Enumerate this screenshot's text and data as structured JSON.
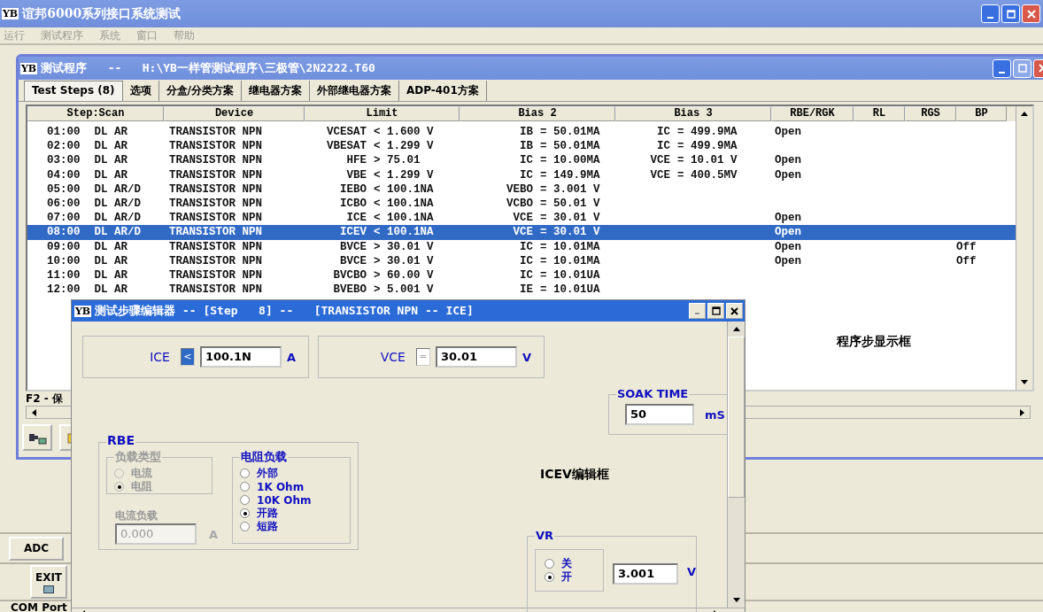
{
  "main_window": {
    "logo": "YB",
    "title": "谊邦6000系列接口系统测试"
  },
  "menu": [
    "运行",
    "测试程序",
    "系统",
    "窗口",
    "帮助"
  ],
  "program_window": {
    "logo": "YB",
    "title": "测试程序   --   H:\\YB一样管测试程序\\三极管\\2N2222.T60"
  },
  "tabs": [
    {
      "label": "Test Steps (8)",
      "selected": true
    },
    {
      "label": "选项",
      "selected": false
    },
    {
      "label": "分盒/分类方案",
      "selected": false
    },
    {
      "label": "继电器方案",
      "selected": false
    },
    {
      "label": "外部继电器方案",
      "selected": false
    },
    {
      "label": "ADP-401方案",
      "selected": false
    }
  ],
  "table": {
    "columns": [
      "Step:Scan",
      "Device",
      "Limit",
      "Bias 2",
      "Bias 3",
      "RBE/RGK",
      "RL",
      "RGS",
      "BP"
    ],
    "rows": [
      {
        "step": "01:00",
        "scan": "DL AR",
        "device": "TRANSISTOR NPN",
        "limit_param": "VCESAT",
        "limit_value": "< 1.600 V",
        "bias2_param": "IB",
        "bias2_value": "= 50.01MA",
        "bias3_param": "IC",
        "bias3_value": "= 499.9MA",
        "rbe": "Open",
        "bp": "",
        "selected": false
      },
      {
        "step": "02:00",
        "scan": "DL AR",
        "device": "TRANSISTOR NPN",
        "limit_param": "VBESAT",
        "limit_value": "< 1.299 V",
        "bias2_param": "IB",
        "bias2_value": "= 50.01MA",
        "bias3_param": "IC",
        "bias3_value": "= 499.9MA",
        "rbe": "",
        "bp": "",
        "selected": false
      },
      {
        "step": "03:00",
        "scan": "DL AR",
        "device": "TRANSISTOR NPN",
        "limit_param": "HFE",
        "limit_value": "> 75.01",
        "bias2_param": "IC",
        "bias2_value": "= 10.00MA",
        "bias3_param": "VCE",
        "bias3_value": "= 10.01 V",
        "rbe": "Open",
        "bp": "",
        "selected": false
      },
      {
        "step": "04:00",
        "scan": "DL AR",
        "device": "TRANSISTOR NPN",
        "limit_param": "VBE",
        "limit_value": "< 1.299 V",
        "bias2_param": "IC",
        "bias2_value": "= 149.9MA",
        "bias3_param": "VCE",
        "bias3_value": "= 400.5MV",
        "rbe": "Open",
        "bp": "",
        "selected": false
      },
      {
        "step": "05:00",
        "scan": "DL AR/D",
        "device": "TRANSISTOR NPN",
        "limit_param": "IEBO",
        "limit_value": "< 100.1NA",
        "bias2_param": "VEBO",
        "bias2_value": "= 3.001 V",
        "bias3_param": "",
        "bias3_value": "",
        "rbe": "",
        "bp": "",
        "selected": false
      },
      {
        "step": "06:00",
        "scan": "DL AR/D",
        "device": "TRANSISTOR NPN",
        "limit_param": "ICBO",
        "limit_value": "< 100.1NA",
        "bias2_param": "VCBO",
        "bias2_value": "= 50.01 V",
        "bias3_param": "",
        "bias3_value": "",
        "rbe": "",
        "bp": "",
        "selected": false
      },
      {
        "step": "07:00",
        "scan": "DL AR/D",
        "device": "TRANSISTOR NPN",
        "limit_param": "ICE",
        "limit_value": "< 100.1NA",
        "bias2_param": "VCE",
        "bias2_value": "= 30.01 V",
        "bias3_param": "",
        "bias3_value": "",
        "rbe": "Open",
        "bp": "",
        "selected": false
      },
      {
        "step": "08:00",
        "scan": "DL AR/D",
        "device": "TRANSISTOR NPN",
        "limit_param": "ICEV",
        "limit_value": "< 100.1NA",
        "bias2_param": "VCE",
        "bias2_value": "= 30.01 V",
        "bias3_param": "",
        "bias3_value": "",
        "rbe": "Open",
        "bp": "",
        "selected": true
      },
      {
        "step": "09:00",
        "scan": "DL AR",
        "device": "TRANSISTOR NPN",
        "limit_param": "BVCE",
        "limit_value": "> 30.01 V",
        "bias2_param": "IC",
        "bias2_value": "= 10.01MA",
        "bias3_param": "",
        "bias3_value": "",
        "rbe": "Open",
        "bp": "Off",
        "selected": false
      },
      {
        "step": "10:00",
        "scan": "DL AR",
        "device": "TRANSISTOR NPN",
        "limit_param": "BVCE",
        "limit_value": "> 30.01 V",
        "bias2_param": "IC",
        "bias2_value": "= 10.01MA",
        "bias3_param": "",
        "bias3_value": "",
        "rbe": "Open",
        "bp": "Off",
        "selected": false
      },
      {
        "step": "11:00",
        "scan": "DL AR",
        "device": "TRANSISTOR NPN",
        "limit_param": "BVCBO",
        "limit_value": "> 60.00 V",
        "bias2_param": "IC",
        "bias2_value": "= 10.01UA",
        "bias3_param": "",
        "bias3_value": "",
        "rbe": "",
        "bp": "",
        "selected": false
      },
      {
        "step": "12:00",
        "scan": "DL AR",
        "device": "TRANSISTOR NPN",
        "limit_param": "BVEBO",
        "limit_value": "> 5.001 V",
        "bias2_param": "IE",
        "bias2_value": "= 10.01UA",
        "bias3_param": "",
        "bias3_value": "",
        "rbe": "",
        "bp": "",
        "selected": false
      }
    ],
    "overlay_label": "程序步显示框",
    "status": "F2 - 保"
  },
  "side_buttons": [
    "ADC",
    "EXIT"
  ],
  "com_port": "COM Port",
  "editor": {
    "logo": "YB",
    "title": "测试步骤编辑器 -- [Step   8] --   [TRANSISTOR NPN -- ICE]",
    "limit": {
      "label": "ICE",
      "operator": {
        "text": "<",
        "selected": true,
        "disabled": false
      },
      "value": "100.1N",
      "unit": "A"
    },
    "bias": {
      "label": "VCE",
      "operator": {
        "text": "=",
        "selected": false,
        "disabled": true
      },
      "value": "30.01",
      "unit": "V"
    },
    "soak_time": {
      "title": "SOAK TIME",
      "value": "50",
      "unit": "mS"
    },
    "rbe": {
      "title": "RBE",
      "load_type": {
        "title": "负载类型",
        "disabled": true,
        "options": [
          {
            "label": "电流",
            "selected": false
          },
          {
            "label": "电阻",
            "selected": true
          }
        ]
      },
      "current_load": {
        "label": "电流负载",
        "value": "0.000",
        "unit": "A",
        "disabled": true
      },
      "resistor_load": {
        "title": "电阻负载",
        "options": [
          {
            "label": "外部",
            "selected": false
          },
          {
            "label": "1K Ohm",
            "selected": false
          },
          {
            "label": "10K Ohm",
            "selected": false
          },
          {
            "label": "开路",
            "selected": true
          },
          {
            "label": "短路",
            "selected": false
          }
        ]
      }
    },
    "caption": "ICEV编辑框",
    "vr": {
      "title": "VR",
      "options": [
        {
          "label": "关",
          "selected": false
        },
        {
          "label": "开",
          "selected": true
        }
      ],
      "value": "3.001",
      "unit": "V"
    }
  }
}
